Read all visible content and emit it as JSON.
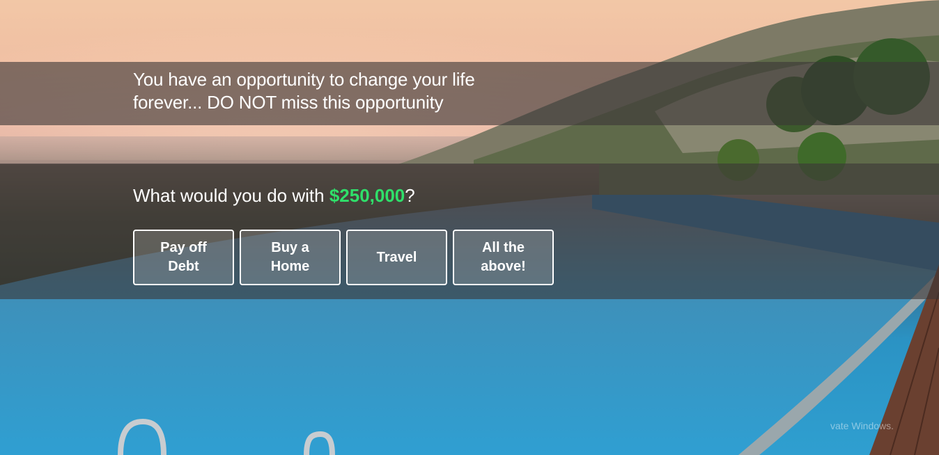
{
  "hero": {
    "headline_line1": "You have an opportunity to change your life",
    "headline_line2": "forever... DO NOT miss this opportunity",
    "question_prefix": "What would you do with ",
    "question_amount": "$250,000",
    "question_suffix": "?",
    "accent_color": "#2fe06a"
  },
  "options": [
    {
      "line1": "Pay off",
      "line2": "Debt"
    },
    {
      "line1": "Buy a",
      "line2": "Home"
    },
    {
      "line1": "Travel",
      "line2": ""
    },
    {
      "line1": "All the",
      "line2": "above!"
    }
  ],
  "watermark": {
    "text": "vate Windows."
  }
}
